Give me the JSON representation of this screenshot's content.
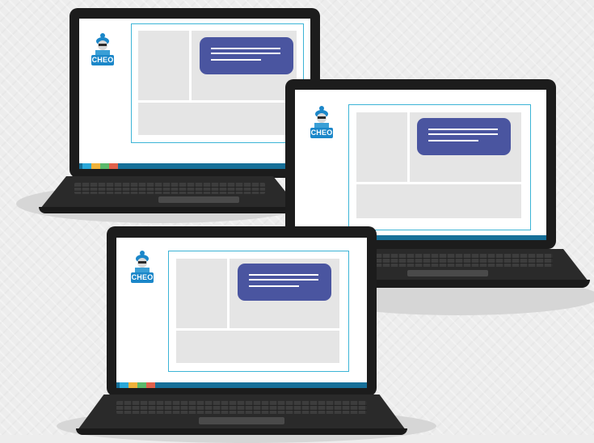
{
  "brand": {
    "logo_text": "CHEO"
  },
  "icons": [
    "mascot-icon"
  ],
  "colors": {
    "background": "#ededed",
    "frame": "#3cb4d6",
    "bubble": "#4a55a0",
    "taskbar": "#166f98",
    "taskbar_items": [
      "#2aa7d9",
      "#f0b23a",
      "#5bb96b",
      "#e0614b"
    ],
    "logo": "#1b87c9"
  }
}
